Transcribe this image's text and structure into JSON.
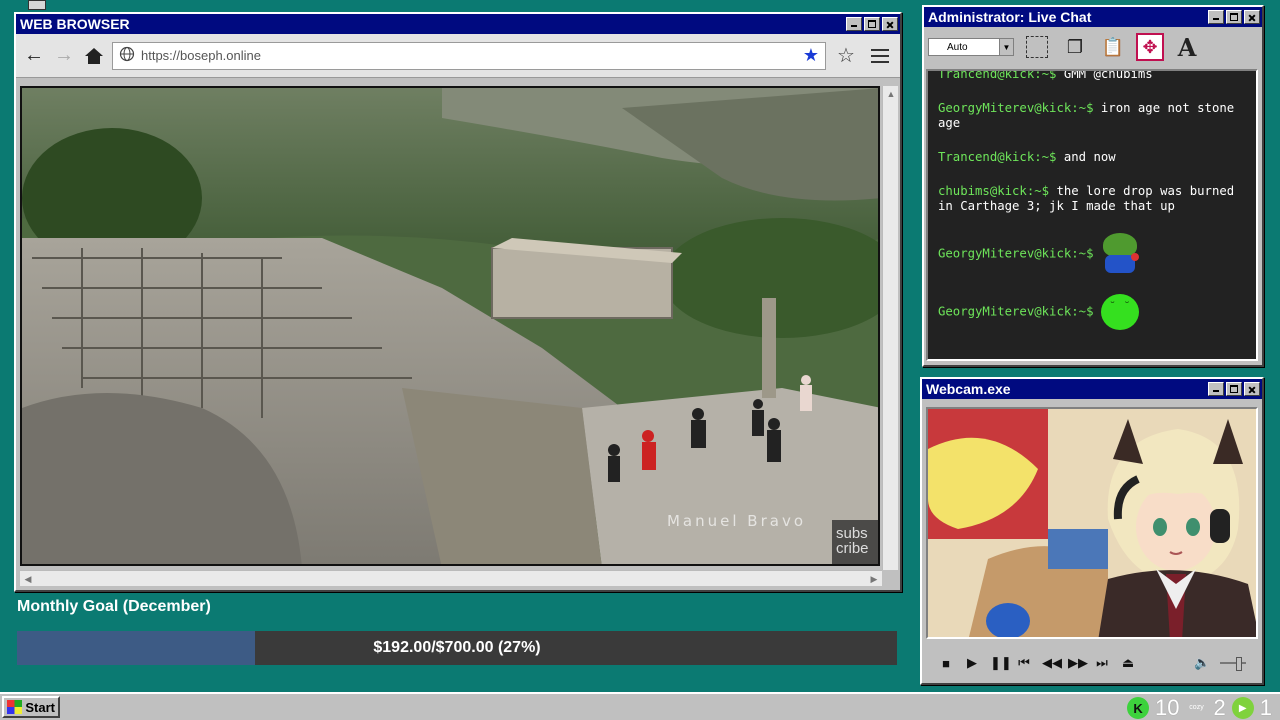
{
  "browser": {
    "title": "WEB BROWSER",
    "url": "https://boseph.online",
    "video": {
      "watermark": "Manuel Bravo",
      "overlay_text": "subs cribe"
    }
  },
  "goal": {
    "title": "Monthly Goal (December)",
    "text": "$192.00/$700.00 (27%)",
    "progress": 0.27,
    "fill_color": "#3d5b85",
    "track_color": "#3a3a3a"
  },
  "chat": {
    "title": "Administrator: Live Chat",
    "font_size_select": "Auto",
    "messages": [
      {
        "user": "Trancend@kick:~$",
        "text": "GMM @chubims"
      },
      {
        "user": "GeorgyMiterev@kick:~$",
        "text": "iron age not stone age"
      },
      {
        "user": "Trancend@kick:~$",
        "text": "and now"
      },
      {
        "user": "chubims@kick:~$",
        "text": "the lore drop was burned in Carthage 3; jk I made that up"
      },
      {
        "user": "GeorgyMiterev@kick:~$",
        "text": "",
        "emote": "pepe-emote"
      },
      {
        "user": "GeorgyMiterev@kick:~$",
        "text": "",
        "emote": "green-blob-emote"
      }
    ],
    "username_color": "#6ee55a"
  },
  "webcam": {
    "title": "Webcam.exe"
  },
  "taskbar": {
    "start_label": "Start",
    "tray": {
      "kick_count": "10",
      "cozy_label": "cozy",
      "cozy_count": "2",
      "play_count": "1"
    }
  },
  "colors": {
    "desktop": "#0b7a72",
    "titlebar": "#000a80",
    "window": "#c0c0c0"
  }
}
